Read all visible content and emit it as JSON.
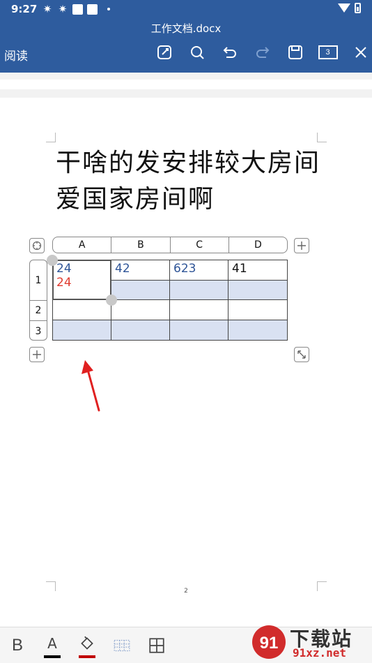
{
  "status_bar": {
    "time": "9:27"
  },
  "header": {
    "doc_title": "工作文档.docx",
    "mode_label": "阅读",
    "page_count": "3",
    "icons": [
      "edit-icon",
      "search-icon",
      "undo-icon",
      "redo-icon",
      "save-icon",
      "page-count-icon",
      "close-icon"
    ]
  },
  "document": {
    "text": "干啥的发安排较大房间爱国家房间啊",
    "page_number": "2"
  },
  "table": {
    "columns": [
      "A",
      "B",
      "C",
      "D"
    ],
    "rows": [
      "1",
      "2",
      "3"
    ],
    "cells": {
      "a1_line1": "24",
      "a1_line2": "24",
      "b1": "42",
      "c1": "623",
      "d1": "41"
    }
  },
  "bottom_toolbar": {
    "bold_label": "B",
    "font_color_label": "A",
    "font_color": "#000000",
    "highlight_color": "#c00000"
  },
  "colors": {
    "header_blue": "#2e5c9e",
    "cell_shade": "#d9e1f2",
    "text_blue": "#2f5597",
    "text_red": "#e03c31",
    "arrow_red": "#e02020"
  },
  "watermark": {
    "line1": "下载站",
    "line2": "91xz.net"
  }
}
